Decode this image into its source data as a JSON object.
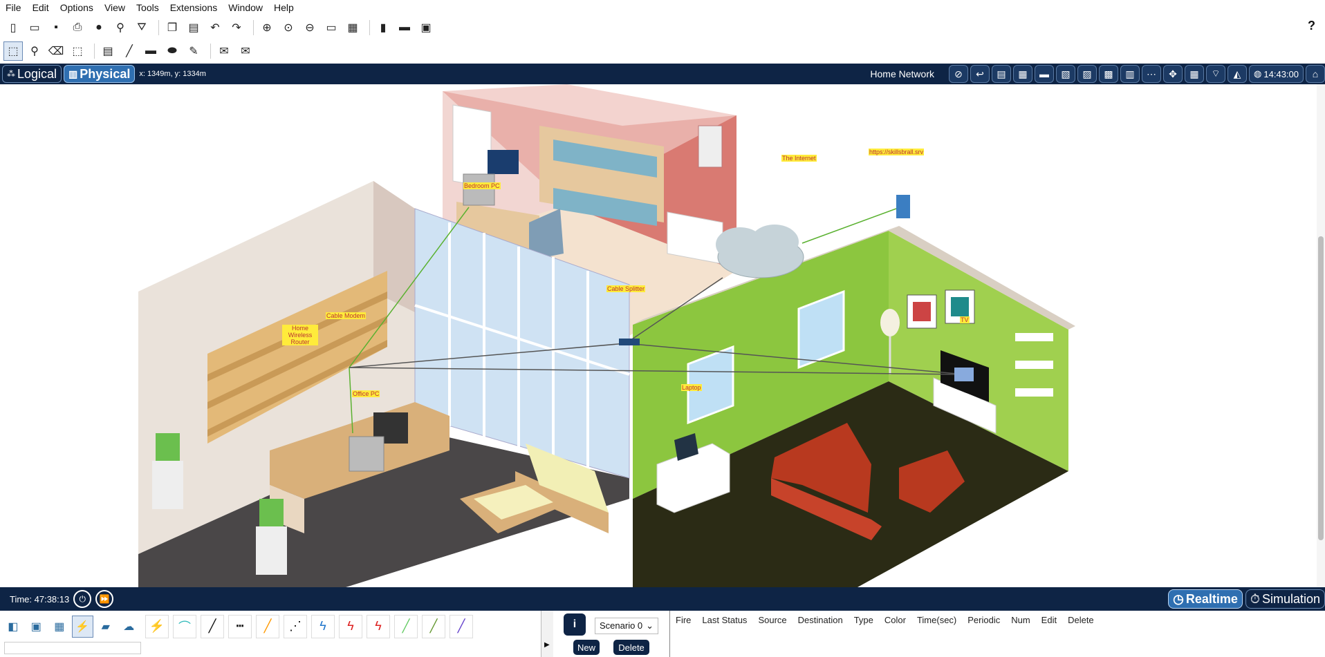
{
  "menu": [
    "File",
    "Edit",
    "Options",
    "View",
    "Tools",
    "Extensions",
    "Window",
    "Help"
  ],
  "toolbar1_icons": [
    "new-icon",
    "open-icon",
    "save-icon",
    "print-icon",
    "info-icon",
    "wizard-icon",
    "network-info-icon",
    "copy-icon",
    "paste-icon",
    "undo-icon",
    "redo-icon",
    "zoom-in-icon",
    "zoom-reset-icon",
    "zoom-out-icon",
    "drawing-palette-icon",
    "custom-device-icon",
    "pdu-list-icon",
    "web-browser-icon",
    "screenshot-icon"
  ],
  "toolbar2_icons": [
    "select-icon",
    "inspect-icon",
    "delete-icon",
    "resize-icon",
    "note-icon",
    "line-icon",
    "rectangle-icon",
    "ellipse-icon",
    "freeform-icon",
    "simple-pdu-icon",
    "complex-pdu-icon"
  ],
  "help_label": "?",
  "nav": {
    "logical_label": "Logical",
    "physical_label": "Physical",
    "coords": "x: 1349m, y: 1334m",
    "network_name": "Home Network",
    "clock": "14:43:00"
  },
  "devices": {
    "bedroom_pc": "Bedroom PC",
    "internet": "The Internet",
    "server": "https://skillsbrall.srv",
    "cable_splitter": "Cable Splitter",
    "cable_modem": "Cable Modem",
    "router": "Home Wireless Router",
    "office_pc": "Office PC",
    "laptop": "Laptop",
    "tv": "TV"
  },
  "status": {
    "time": "Time: 47:38:13",
    "realtime_label": "Realtime",
    "simulation_label": "Simulation"
  },
  "scenario": {
    "info_label": "i",
    "selected": "Scenario 0",
    "new_label": "New",
    "delete_label": "Delete"
  },
  "pdu_columns": [
    "Fire",
    "Last Status",
    "Source",
    "Destination",
    "Type",
    "Color",
    "Time(sec)",
    "Periodic",
    "Num",
    "Edit",
    "Delete"
  ],
  "colors": {
    "nav_bg": "#0e2445",
    "active_mode": "#2f6fb1",
    "label_bg": "#ffeb3b",
    "living_room_wall": "#8cc63f",
    "floor_dark": "#2b2b15",
    "office_floor": "#4a4748"
  }
}
